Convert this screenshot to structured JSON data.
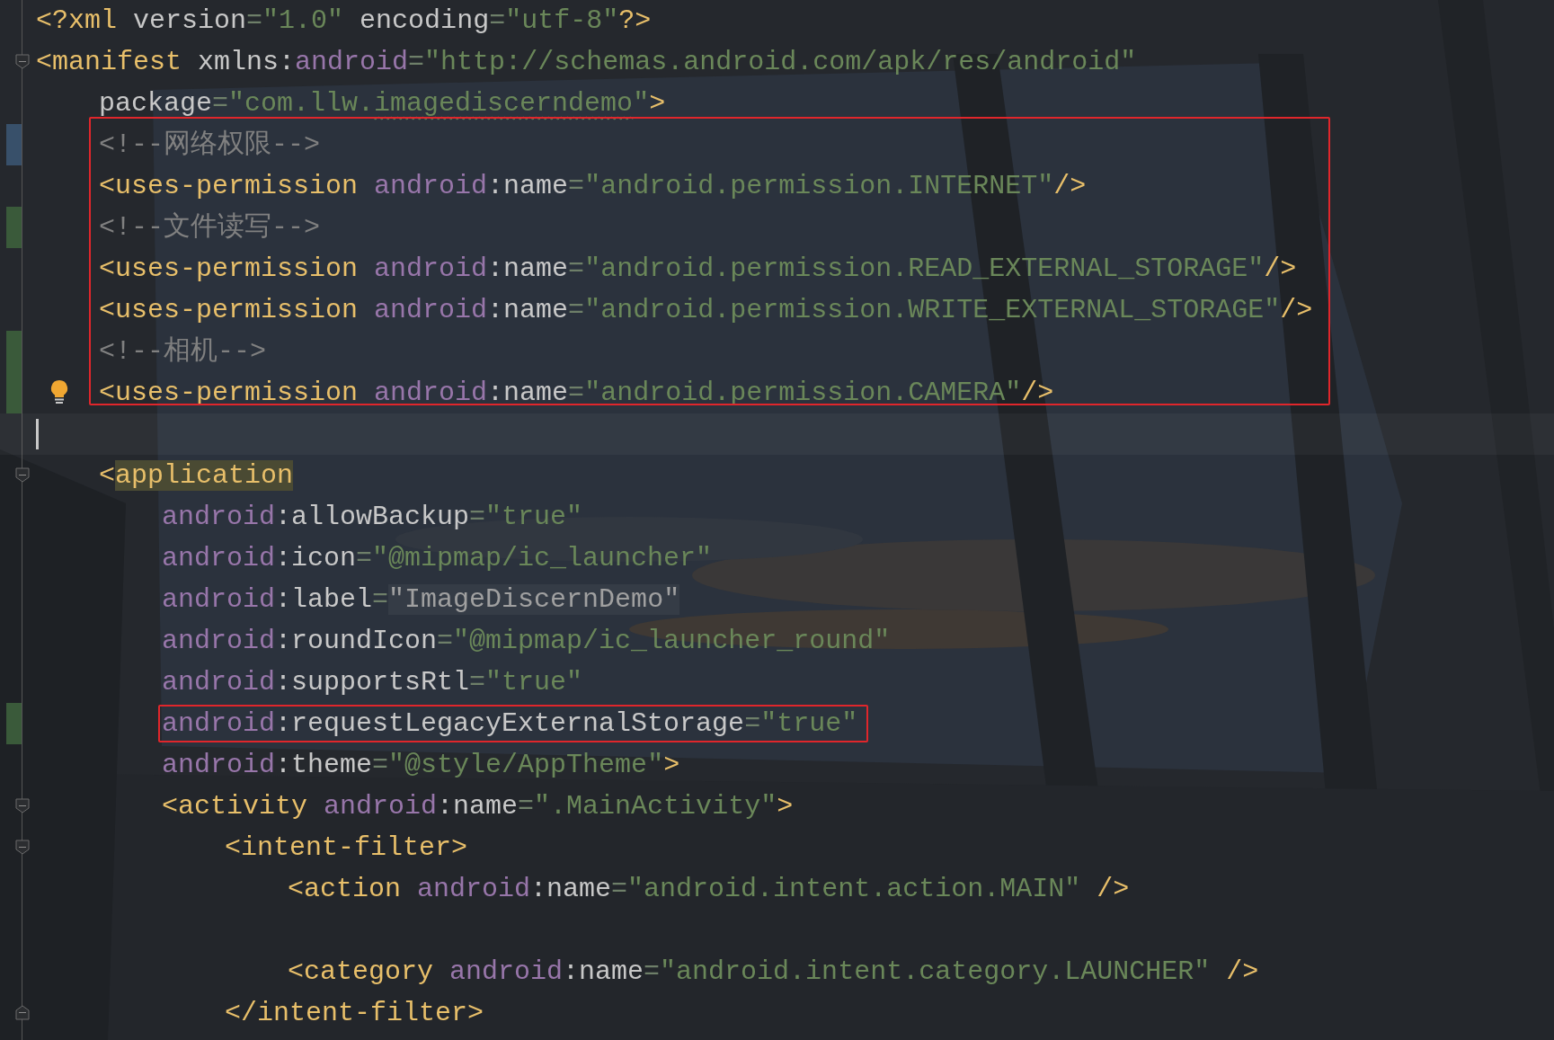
{
  "editor": {
    "lines": [
      {
        "tokens": [
          {
            "kind": "tag",
            "text": "<?xml "
          },
          {
            "kind": "attr",
            "text": "version"
          },
          {
            "kind": "eq",
            "text": "="
          },
          {
            "kind": "string",
            "text": "\"1.0\" "
          },
          {
            "kind": "attr",
            "text": "encoding"
          },
          {
            "kind": "eq",
            "text": "="
          },
          {
            "kind": "string",
            "text": "\"utf-8\""
          },
          {
            "kind": "tag",
            "text": "?>"
          }
        ]
      },
      {
        "fold_open": true,
        "tokens": [
          {
            "kind": "tag",
            "text": "<manifest "
          },
          {
            "kind": "attr",
            "text": "xmlns:"
          },
          {
            "kind": "ns",
            "text": "android"
          },
          {
            "kind": "eq",
            "text": "="
          },
          {
            "kind": "string",
            "text": "\"http://schemas.android.com/apk/res/android\""
          }
        ],
        "children": [
          {
            "tokens": [
              {
                "kind": "attr",
                "text": "package"
              },
              {
                "kind": "eq",
                "text": "="
              },
              {
                "kind": "string",
                "text": "\"com.llw."
              },
              {
                "kind": "string",
                "text": "imagediscerndemo",
                "typo": true
              },
              {
                "kind": "string",
                "text": "\""
              },
              {
                "kind": "tag",
                "text": ">"
              }
            ]
          },
          {
            "framed": true,
            "modified": true,
            "tokens": [
              {
                "kind": "comment",
                "text": "<!--网络权限-->"
              }
            ]
          },
          {
            "framed": true,
            "tokens": [
              {
                "kind": "tag",
                "text": "<uses-permission "
              },
              {
                "kind": "ns",
                "text": "android"
              },
              {
                "kind": "attr",
                "text": ":name"
              },
              {
                "kind": "eq",
                "text": "="
              },
              {
                "kind": "string",
                "text": "\"android.permission.INTERNET\""
              },
              {
                "kind": "tag",
                "text": "/>"
              }
            ]
          },
          {
            "framed": true,
            "added": true,
            "tokens": [
              {
                "kind": "comment",
                "text": "<!--文件读写-->"
              }
            ]
          },
          {
            "framed": true,
            "tokens": [
              {
                "kind": "tag",
                "text": "<uses-permission "
              },
              {
                "kind": "ns",
                "text": "android"
              },
              {
                "kind": "attr",
                "text": ":name"
              },
              {
                "kind": "eq",
                "text": "="
              },
              {
                "kind": "string",
                "text": "\"android.permission.READ_EXTERNAL_STORAGE\""
              },
              {
                "kind": "tag",
                "text": "/>"
              }
            ]
          },
          {
            "framed": true,
            "tokens": [
              {
                "kind": "tag",
                "text": "<uses-permission "
              },
              {
                "kind": "ns",
                "text": "android"
              },
              {
                "kind": "attr",
                "text": ":name"
              },
              {
                "kind": "eq",
                "text": "="
              },
              {
                "kind": "string",
                "text": "\"android.permission.WRITE_EXTERNAL_STORAGE\""
              },
              {
                "kind": "tag",
                "text": "/>"
              }
            ]
          },
          {
            "framed": true,
            "added": true,
            "tokens": [
              {
                "kind": "comment",
                "text": "<!--相机-->"
              }
            ]
          },
          {
            "framed": true,
            "added": true,
            "bulb": true,
            "tokens": [
              {
                "kind": "tag",
                "text": "<uses-permission "
              },
              {
                "kind": "ns",
                "text": "android"
              },
              {
                "kind": "attr",
                "text": ":name"
              },
              {
                "kind": "eq",
                "text": "="
              },
              {
                "kind": "string",
                "text": "\"android.permission.CAMERA\""
              },
              {
                "kind": "tag",
                "text": "/>"
              }
            ]
          },
          {
            "caret": true
          },
          {
            "fold_open": true,
            "tokens": [
              {
                "kind": "tag",
                "text": "<"
              },
              {
                "kind": "tag",
                "text": "application",
                "matched": true
              }
            ],
            "children": [
              {
                "tokens": [
                  {
                    "kind": "ns",
                    "text": "android"
                  },
                  {
                    "kind": "attr",
                    "text": ":allowBackup"
                  },
                  {
                    "kind": "eq",
                    "text": "="
                  },
                  {
                    "kind": "string",
                    "text": "\"true\""
                  }
                ]
              },
              {
                "tokens": [
                  {
                    "kind": "ns",
                    "text": "android"
                  },
                  {
                    "kind": "attr",
                    "text": ":icon"
                  },
                  {
                    "kind": "eq",
                    "text": "="
                  },
                  {
                    "kind": "string",
                    "text": "\"@mipmap/ic_launcher\""
                  }
                ]
              },
              {
                "tokens": [
                  {
                    "kind": "ns",
                    "text": "android"
                  },
                  {
                    "kind": "attr",
                    "text": ":label"
                  },
                  {
                    "kind": "eq",
                    "text": "="
                  },
                  {
                    "kind": "resolved",
                    "text": "\"ImageDiscernDemo\""
                  }
                ]
              },
              {
                "tokens": [
                  {
                    "kind": "ns",
                    "text": "android"
                  },
                  {
                    "kind": "attr",
                    "text": ":roundIcon"
                  },
                  {
                    "kind": "eq",
                    "text": "="
                  },
                  {
                    "kind": "string",
                    "text": "\"@mipmap/ic_launcher_round\""
                  }
                ]
              },
              {
                "tokens": [
                  {
                    "kind": "ns",
                    "text": "android"
                  },
                  {
                    "kind": "attr",
                    "text": ":supportsRtl"
                  },
                  {
                    "kind": "eq",
                    "text": "="
                  },
                  {
                    "kind": "string",
                    "text": "\"true\""
                  }
                ]
              },
              {
                "added": true,
                "tokens": [
                  {
                    "kind": "ns",
                    "text": "android",
                    "boxed": true
                  },
                  {
                    "kind": "attr",
                    "text": ":requestLegacyExternalStorage",
                    "boxed": true
                  },
                  {
                    "kind": "eq",
                    "text": "=",
                    "boxed": true
                  },
                  {
                    "kind": "string",
                    "text": "\"true\"",
                    "boxed": true
                  }
                ]
              },
              {
                "tokens": [
                  {
                    "kind": "ns",
                    "text": "android"
                  },
                  {
                    "kind": "attr",
                    "text": ":theme"
                  },
                  {
                    "kind": "eq",
                    "text": "="
                  },
                  {
                    "kind": "string",
                    "text": "\"@style/AppTheme\""
                  },
                  {
                    "kind": "tag",
                    "text": ">"
                  }
                ]
              },
              {
                "fold_open": true,
                "tokens": [
                  {
                    "kind": "tag",
                    "text": "<activity "
                  },
                  {
                    "kind": "ns",
                    "text": "android"
                  },
                  {
                    "kind": "attr",
                    "text": ":name"
                  },
                  {
                    "kind": "eq",
                    "text": "="
                  },
                  {
                    "kind": "string",
                    "text": "\".MainActivity\""
                  },
                  {
                    "kind": "tag",
                    "text": ">"
                  }
                ],
                "children": [
                  {
                    "fold_open": true,
                    "tokens": [
                      {
                        "kind": "tag",
                        "text": "<intent-filter>"
                      }
                    ],
                    "children": [
                      {
                        "blank_after": true,
                        "tokens": [
                          {
                            "kind": "tag",
                            "text": "<action "
                          },
                          {
                            "kind": "ns",
                            "text": "android"
                          },
                          {
                            "kind": "attr",
                            "text": ":name"
                          },
                          {
                            "kind": "eq",
                            "text": "="
                          },
                          {
                            "kind": "string",
                            "text": "\"android.intent.action.MAIN\" "
                          },
                          {
                            "kind": "tag",
                            "text": "/>"
                          }
                        ]
                      },
                      {
                        "tokens": [
                          {
                            "kind": "tag",
                            "text": "<category "
                          },
                          {
                            "kind": "ns",
                            "text": "android"
                          },
                          {
                            "kind": "attr",
                            "text": ":name"
                          },
                          {
                            "kind": "eq",
                            "text": "="
                          },
                          {
                            "kind": "string",
                            "text": "\"android.intent.category.LAUNCHER\" "
                          },
                          {
                            "kind": "tag",
                            "text": "/>"
                          }
                        ]
                      }
                    ]
                  },
                  {
                    "fold_close": true,
                    "tokens": [
                      {
                        "kind": "tag",
                        "text": "</intent-filter>"
                      }
                    ]
                  }
                ]
              }
            ]
          }
        ]
      }
    ]
  }
}
